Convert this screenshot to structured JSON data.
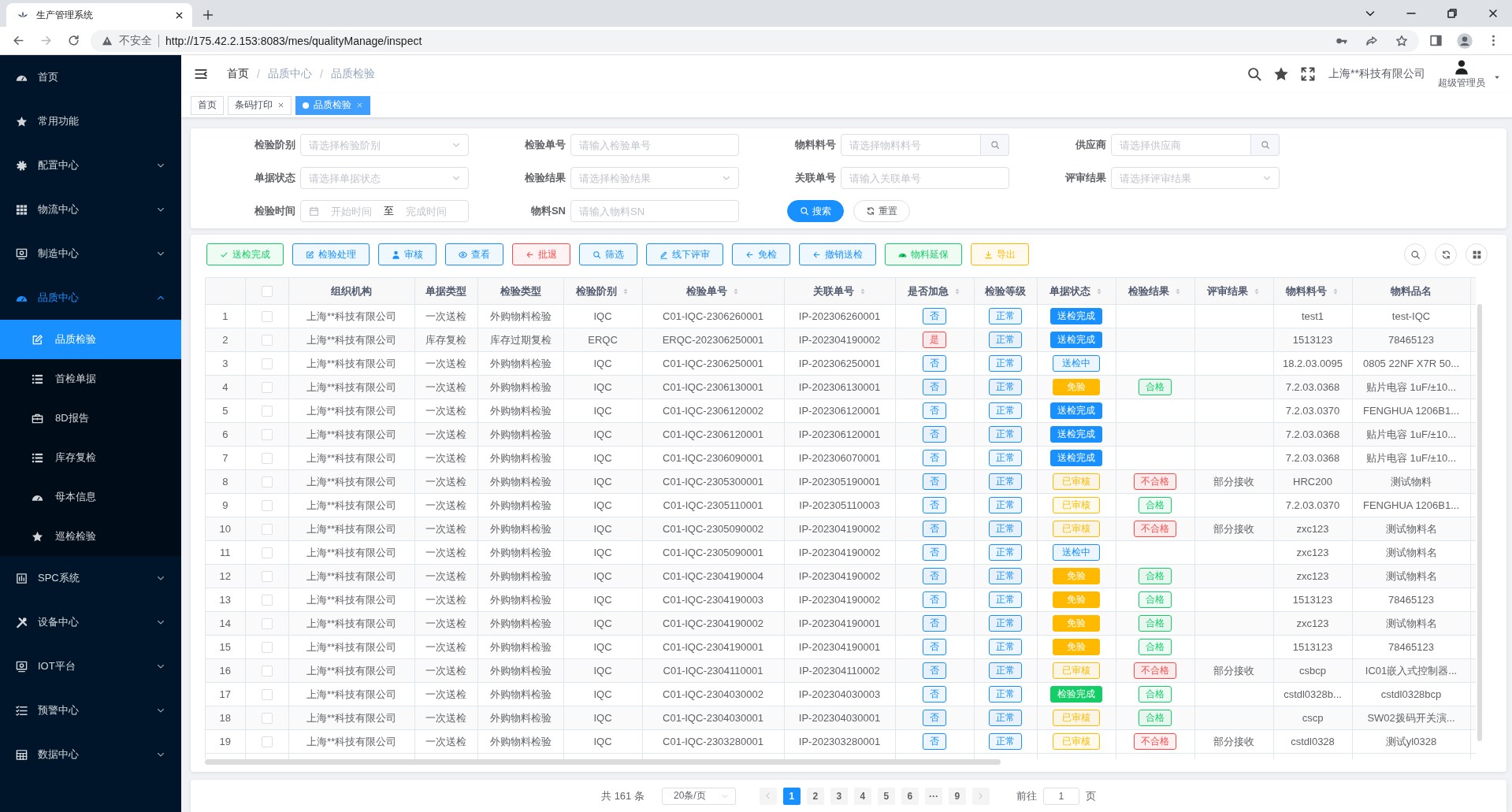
{
  "browser": {
    "tab_title": "生产管理系统",
    "security": "不安全",
    "url": "http://175.42.2.153:8083/mes/qualityManage/inspect"
  },
  "sidebar": {
    "items": [
      {
        "label": "首页"
      },
      {
        "label": "常用功能"
      },
      {
        "label": "配置中心",
        "expanded": false
      },
      {
        "label": "物流中心",
        "expanded": false
      },
      {
        "label": "制造中心",
        "expanded": false
      },
      {
        "label": "品质中心",
        "expanded": true,
        "children": [
          {
            "label": "品质检验",
            "selected": true
          },
          {
            "label": "首检单据",
            "selected": false
          },
          {
            "label": "8D报告",
            "selected": false
          },
          {
            "label": "库存复检",
            "selected": false
          },
          {
            "label": "母本信息",
            "selected": false
          },
          {
            "label": "巡检检验",
            "selected": false
          }
        ]
      },
      {
        "label": "SPC系统",
        "expanded": false
      },
      {
        "label": "设备中心",
        "expanded": false
      },
      {
        "label": "IOT平台",
        "expanded": false
      },
      {
        "label": "预警中心",
        "expanded": false
      },
      {
        "label": "数据中心",
        "expanded": false
      }
    ]
  },
  "header": {
    "breadcrumb": [
      {
        "label": "首页",
        "link": true
      },
      {
        "label": "品质中心",
        "link": false
      },
      {
        "label": "品质检验",
        "link": false
      }
    ],
    "separator": "/",
    "company": "上海**科技有限公司",
    "user": "超级管理员"
  },
  "tabs": [
    {
      "label": "首页",
      "selected": false,
      "closable": false
    },
    {
      "label": "条码打印",
      "selected": false,
      "closable": true
    },
    {
      "label": "品质检验",
      "selected": true,
      "closable": true
    }
  ],
  "filters": {
    "fields": [
      {
        "label": "检验阶别",
        "kind": "select",
        "placeholder": "请选择检验阶别"
      },
      {
        "label": "检验单号",
        "kind": "input",
        "placeholder": "请输入检验单号"
      },
      {
        "label": "物料料号",
        "kind": "lookup",
        "placeholder": "请选择物料料号"
      },
      {
        "label": "供应商",
        "kind": "lookup",
        "placeholder": "请选择供应商"
      },
      {
        "label": "单据状态",
        "kind": "select",
        "placeholder": "请选择单据状态"
      },
      {
        "label": "检验结果",
        "kind": "select",
        "placeholder": "请选择检验结果"
      },
      {
        "label": "关联单号",
        "kind": "input",
        "placeholder": "请输入关联单号"
      },
      {
        "label": "评审结果",
        "kind": "select",
        "placeholder": "请选择评审结果"
      },
      {
        "label": "检验时间",
        "kind": "daterange",
        "start_placeholder": "开始时间",
        "separator": "至",
        "end_placeholder": "完成时间"
      },
      {
        "label": "物料SN",
        "kind": "input",
        "placeholder": "请输入物料SN"
      }
    ],
    "buttons": [
      {
        "label": "搜索",
        "kind": "primary"
      },
      {
        "label": "重置",
        "kind": "default"
      }
    ]
  },
  "toolbar": {
    "buttons": [
      {
        "label": "送检完成",
        "color": "#13ce66"
      },
      {
        "label": "检验处理",
        "color": "#1890ff"
      },
      {
        "label": "审核",
        "color": "#1890ff"
      },
      {
        "label": "查看",
        "color": "#1890ff"
      },
      {
        "label": "批退",
        "color": "#ff4949"
      },
      {
        "label": "筛选",
        "color": "#1890ff"
      },
      {
        "label": "线下评审",
        "color": "#1890ff"
      },
      {
        "label": "免检",
        "color": "#1890ff"
      },
      {
        "label": "撤销送检",
        "color": "#1890ff"
      },
      {
        "label": "物料延保",
        "color": "#13ce66"
      },
      {
        "label": "导出",
        "color": "#ffba00"
      }
    ]
  },
  "table": {
    "all_checked": false,
    "columns": [
      {
        "label": "组织机构",
        "sortable": false
      },
      {
        "label": "单据类型",
        "sortable": false
      },
      {
        "label": "检验类型",
        "sortable": false
      },
      {
        "label": "检验阶别",
        "sortable": true
      },
      {
        "label": "检验单号",
        "sortable": true
      },
      {
        "label": "关联单号",
        "sortable": true
      },
      {
        "label": "是否加急",
        "sortable": true
      },
      {
        "label": "检验等级",
        "sortable": false
      },
      {
        "label": "单据状态",
        "sortable": true
      },
      {
        "label": "检验结果",
        "sortable": true
      },
      {
        "label": "评审结果",
        "sortable": true
      },
      {
        "label": "物料料号",
        "sortable": true
      },
      {
        "label": "物料品名",
        "sortable": false
      }
    ],
    "rows": [
      {
        "no": "1",
        "checked": false,
        "org": "上海**科技有限公司",
        "doc_type": "一次送检",
        "inspect_type": "外购物料检验",
        "stage": "IQC",
        "inspect_no": "C01-IQC-2306260001",
        "related_no": "IP-202306260001",
        "urgent": {
          "text": "否",
          "color": "#1890ff",
          "solid": false
        },
        "grade": {
          "text": "正常",
          "color": "#1890ff",
          "solid": false
        },
        "status": {
          "text": "送检完成",
          "color": "#1890ff",
          "solid": true
        },
        "material_no": "test1",
        "material_name": "test-IQC"
      },
      {
        "no": "2",
        "checked": false,
        "org": "上海**科技有限公司",
        "doc_type": "库存复检",
        "inspect_type": "库存过期复检",
        "stage": "ERQC",
        "inspect_no": "ERQC-202306250001",
        "related_no": "IP-202304190002",
        "urgent": {
          "text": "是",
          "color": "#ff4949",
          "solid": false
        },
        "grade": {
          "text": "正常",
          "color": "#1890ff",
          "solid": false
        },
        "status": {
          "text": "送检完成",
          "color": "#1890ff",
          "solid": true
        },
        "material_no": "1513123",
        "material_name": "78465123"
      },
      {
        "no": "3",
        "checked": false,
        "org": "上海**科技有限公司",
        "doc_type": "一次送检",
        "inspect_type": "外购物料检验",
        "stage": "IQC",
        "inspect_no": "C01-IQC-2306250001",
        "related_no": "IP-202306250001",
        "urgent": {
          "text": "否",
          "color": "#1890ff",
          "solid": false
        },
        "grade": {
          "text": "正常",
          "color": "#1890ff",
          "solid": false
        },
        "status": {
          "text": "送检中",
          "color": "#1890ff",
          "solid": false
        },
        "material_no": "18.2.03.0095",
        "material_name": "0805 22NF X7R 50..."
      },
      {
        "no": "4",
        "checked": false,
        "org": "上海**科技有限公司",
        "doc_type": "一次送检",
        "inspect_type": "外购物料检验",
        "stage": "IQC",
        "inspect_no": "C01-IQC-2306130001",
        "related_no": "IP-202306130001",
        "urgent": {
          "text": "否",
          "color": "#1890ff",
          "solid": false
        },
        "grade": {
          "text": "正常",
          "color": "#1890ff",
          "solid": false
        },
        "status": {
          "text": "免验",
          "color": "#ffba00",
          "solid": true
        },
        "result": {
          "text": "合格",
          "color": "#13ce66",
          "solid": false
        },
        "material_no": "7.2.03.0368",
        "material_name": "贴片电容 1uF/±10..."
      },
      {
        "no": "5",
        "checked": false,
        "org": "上海**科技有限公司",
        "doc_type": "一次送检",
        "inspect_type": "外购物料检验",
        "stage": "IQC",
        "inspect_no": "C01-IQC-2306120002",
        "related_no": "IP-202306120001",
        "urgent": {
          "text": "否",
          "color": "#1890ff",
          "solid": false
        },
        "grade": {
          "text": "正常",
          "color": "#1890ff",
          "solid": false
        },
        "status": {
          "text": "送检完成",
          "color": "#1890ff",
          "solid": true
        },
        "material_no": "7.2.03.0370",
        "material_name": "FENGHUA 1206B1..."
      },
      {
        "no": "6",
        "checked": false,
        "org": "上海**科技有限公司",
        "doc_type": "一次送检",
        "inspect_type": "外购物料检验",
        "stage": "IQC",
        "inspect_no": "C01-IQC-2306120001",
        "related_no": "IP-202306120001",
        "urgent": {
          "text": "否",
          "color": "#1890ff",
          "solid": false
        },
        "grade": {
          "text": "正常",
          "color": "#1890ff",
          "solid": false
        },
        "status": {
          "text": "送检完成",
          "color": "#1890ff",
          "solid": true
        },
        "material_no": "7.2.03.0368",
        "material_name": "贴片电容 1uF/±10..."
      },
      {
        "no": "7",
        "checked": false,
        "org": "上海**科技有限公司",
        "doc_type": "一次送检",
        "inspect_type": "外购物料检验",
        "stage": "IQC",
        "inspect_no": "C01-IQC-2306090001",
        "related_no": "IP-202306070001",
        "urgent": {
          "text": "否",
          "color": "#1890ff",
          "solid": false
        },
        "grade": {
          "text": "正常",
          "color": "#1890ff",
          "solid": false
        },
        "status": {
          "text": "送检完成",
          "color": "#1890ff",
          "solid": true
        },
        "material_no": "7.2.03.0368",
        "material_name": "贴片电容 1uF/±10..."
      },
      {
        "no": "8",
        "checked": false,
        "org": "上海**科技有限公司",
        "doc_type": "一次送检",
        "inspect_type": "外购物料检验",
        "stage": "IQC",
        "inspect_no": "C01-IQC-2305300001",
        "related_no": "IP-202305190001",
        "urgent": {
          "text": "否",
          "color": "#1890ff",
          "solid": false
        },
        "grade": {
          "text": "正常",
          "color": "#1890ff",
          "solid": false
        },
        "status": {
          "text": "已审核",
          "color": "#ffba00",
          "solid": false
        },
        "result": {
          "text": "不合格",
          "color": "#ff4949",
          "solid": false
        },
        "review": "部分接收",
        "material_no": "HRC200",
        "material_name": "测试物料"
      },
      {
        "no": "9",
        "checked": false,
        "org": "上海**科技有限公司",
        "doc_type": "一次送检",
        "inspect_type": "外购物料检验",
        "stage": "IQC",
        "inspect_no": "C01-IQC-2305110001",
        "related_no": "IP-202305110003",
        "urgent": {
          "text": "否",
          "color": "#1890ff",
          "solid": false
        },
        "grade": {
          "text": "正常",
          "color": "#1890ff",
          "solid": false
        },
        "status": {
          "text": "已审核",
          "color": "#ffba00",
          "solid": false
        },
        "result": {
          "text": "合格",
          "color": "#13ce66",
          "solid": false
        },
        "material_no": "7.2.03.0370",
        "material_name": "FENGHUA 1206B1..."
      },
      {
        "no": "10",
        "checked": false,
        "org": "上海**科技有限公司",
        "doc_type": "一次送检",
        "inspect_type": "外购物料检验",
        "stage": "IQC",
        "inspect_no": "C01-IQC-2305090002",
        "related_no": "IP-202304190002",
        "urgent": {
          "text": "否",
          "color": "#1890ff",
          "solid": false
        },
        "grade": {
          "text": "正常",
          "color": "#1890ff",
          "solid": false
        },
        "status": {
          "text": "已审核",
          "color": "#ffba00",
          "solid": false
        },
        "result": {
          "text": "不合格",
          "color": "#ff4949",
          "solid": false
        },
        "review": "部分接收",
        "material_no": "zxc123",
        "material_name": "测试物料名"
      },
      {
        "no": "11",
        "checked": false,
        "org": "上海**科技有限公司",
        "doc_type": "一次送检",
        "inspect_type": "外购物料检验",
        "stage": "IQC",
        "inspect_no": "C01-IQC-2305090001",
        "related_no": "IP-202304190002",
        "urgent": {
          "text": "否",
          "color": "#1890ff",
          "solid": false
        },
        "grade": {
          "text": "正常",
          "color": "#1890ff",
          "solid": false
        },
        "status": {
          "text": "送检中",
          "color": "#1890ff",
          "solid": false
        },
        "material_no": "zxc123",
        "material_name": "测试物料名"
      },
      {
        "no": "12",
        "checked": false,
        "org": "上海**科技有限公司",
        "doc_type": "一次送检",
        "inspect_type": "外购物料检验",
        "stage": "IQC",
        "inspect_no": "C01-IQC-2304190004",
        "related_no": "IP-202304190002",
        "urgent": {
          "text": "否",
          "color": "#1890ff",
          "solid": false
        },
        "grade": {
          "text": "正常",
          "color": "#1890ff",
          "solid": false
        },
        "status": {
          "text": "免验",
          "color": "#ffba00",
          "solid": true
        },
        "result": {
          "text": "合格",
          "color": "#13ce66",
          "solid": false
        },
        "material_no": "zxc123",
        "material_name": "测试物料名"
      },
      {
        "no": "13",
        "checked": false,
        "org": "上海**科技有限公司",
        "doc_type": "一次送检",
        "inspect_type": "外购物料检验",
        "stage": "IQC",
        "inspect_no": "C01-IQC-2304190003",
        "related_no": "IP-202304190002",
        "urgent": {
          "text": "否",
          "color": "#1890ff",
          "solid": false
        },
        "grade": {
          "text": "正常",
          "color": "#1890ff",
          "solid": false
        },
        "status": {
          "text": "免验",
          "color": "#ffba00",
          "solid": true
        },
        "result": {
          "text": "合格",
          "color": "#13ce66",
          "solid": false
        },
        "material_no": "1513123",
        "material_name": "78465123"
      },
      {
        "no": "14",
        "checked": false,
        "org": "上海**科技有限公司",
        "doc_type": "一次送检",
        "inspect_type": "外购物料检验",
        "stage": "IQC",
        "inspect_no": "C01-IQC-2304190002",
        "related_no": "IP-202304190001",
        "urgent": {
          "text": "否",
          "color": "#1890ff",
          "solid": false
        },
        "grade": {
          "text": "正常",
          "color": "#1890ff",
          "solid": false
        },
        "status": {
          "text": "免验",
          "color": "#ffba00",
          "solid": true
        },
        "result": {
          "text": "合格",
          "color": "#13ce66",
          "solid": false
        },
        "material_no": "zxc123",
        "material_name": "测试物料名"
      },
      {
        "no": "15",
        "checked": false,
        "org": "上海**科技有限公司",
        "doc_type": "一次送检",
        "inspect_type": "外购物料检验",
        "stage": "IQC",
        "inspect_no": "C01-IQC-2304190001",
        "related_no": "IP-202304190001",
        "urgent": {
          "text": "否",
          "color": "#1890ff",
          "solid": false
        },
        "grade": {
          "text": "正常",
          "color": "#1890ff",
          "solid": false
        },
        "status": {
          "text": "免验",
          "color": "#ffba00",
          "solid": true
        },
        "result": {
          "text": "合格",
          "color": "#13ce66",
          "solid": false
        },
        "material_no": "1513123",
        "material_name": "78465123"
      },
      {
        "no": "16",
        "checked": false,
        "org": "上海**科技有限公司",
        "doc_type": "一次送检",
        "inspect_type": "外购物料检验",
        "stage": "IQC",
        "inspect_no": "C01-IQC-2304110001",
        "related_no": "IP-202304110002",
        "urgent": {
          "text": "否",
          "color": "#1890ff",
          "solid": false
        },
        "grade": {
          "text": "正常",
          "color": "#1890ff",
          "solid": false
        },
        "status": {
          "text": "已审核",
          "color": "#ffba00",
          "solid": false
        },
        "result": {
          "text": "不合格",
          "color": "#ff4949",
          "solid": false
        },
        "review": "部分接收",
        "material_no": "csbcp",
        "material_name": "IC01嵌入式控制器..."
      },
      {
        "no": "17",
        "checked": false,
        "org": "上海**科技有限公司",
        "doc_type": "一次送检",
        "inspect_type": "外购物料检验",
        "stage": "IQC",
        "inspect_no": "C01-IQC-2304030002",
        "related_no": "IP-202304030003",
        "urgent": {
          "text": "否",
          "color": "#1890ff",
          "solid": false
        },
        "grade": {
          "text": "正常",
          "color": "#1890ff",
          "solid": false
        },
        "status": {
          "text": "检验完成",
          "color": "#13ce66",
          "solid": true
        },
        "result": {
          "text": "合格",
          "color": "#13ce66",
          "solid": false
        },
        "material_no": "cstdl0328b...",
        "material_name": "cstdl0328bcp"
      },
      {
        "no": "18",
        "checked": false,
        "org": "上海**科技有限公司",
        "doc_type": "一次送检",
        "inspect_type": "外购物料检验",
        "stage": "IQC",
        "inspect_no": "C01-IQC-2304030001",
        "related_no": "IP-202304030001",
        "urgent": {
          "text": "否",
          "color": "#1890ff",
          "solid": false
        },
        "grade": {
          "text": "正常",
          "color": "#1890ff",
          "solid": false
        },
        "status": {
          "text": "已审核",
          "color": "#ffba00",
          "solid": false
        },
        "result": {
          "text": "合格",
          "color": "#13ce66",
          "solid": false
        },
        "material_no": "cscp",
        "material_name": "SW02拨码开关演..."
      },
      {
        "no": "19",
        "checked": false,
        "org": "上海**科技有限公司",
        "doc_type": "一次送检",
        "inspect_type": "外购物料检验",
        "stage": "IQC",
        "inspect_no": "C01-IQC-2303280001",
        "related_no": "IP-202303280001",
        "urgent": {
          "text": "否",
          "color": "#1890ff",
          "solid": false
        },
        "grade": {
          "text": "正常",
          "color": "#1890ff",
          "solid": false
        },
        "status": {
          "text": "已审核",
          "color": "#ffba00",
          "solid": false
        },
        "result": {
          "text": "不合格",
          "color": "#ff4949",
          "solid": false
        },
        "review": "部分接收",
        "material_no": "cstdl0328",
        "material_name": "测试yl0328"
      }
    ]
  },
  "pagination": {
    "total": "共 161 条",
    "page_size": "20条/页",
    "pages": [
      {
        "label": "1",
        "selected": true
      },
      {
        "label": "2",
        "selected": false
      },
      {
        "label": "3",
        "selected": false
      },
      {
        "label": "4",
        "selected": false
      },
      {
        "label": "5",
        "selected": false
      },
      {
        "label": "6",
        "selected": false
      },
      {
        "label": "···",
        "selected": false
      },
      {
        "label": "9",
        "selected": false
      }
    ],
    "goto_label": "前往",
    "goto_value": "1",
    "goto_suffix": "页"
  }
}
